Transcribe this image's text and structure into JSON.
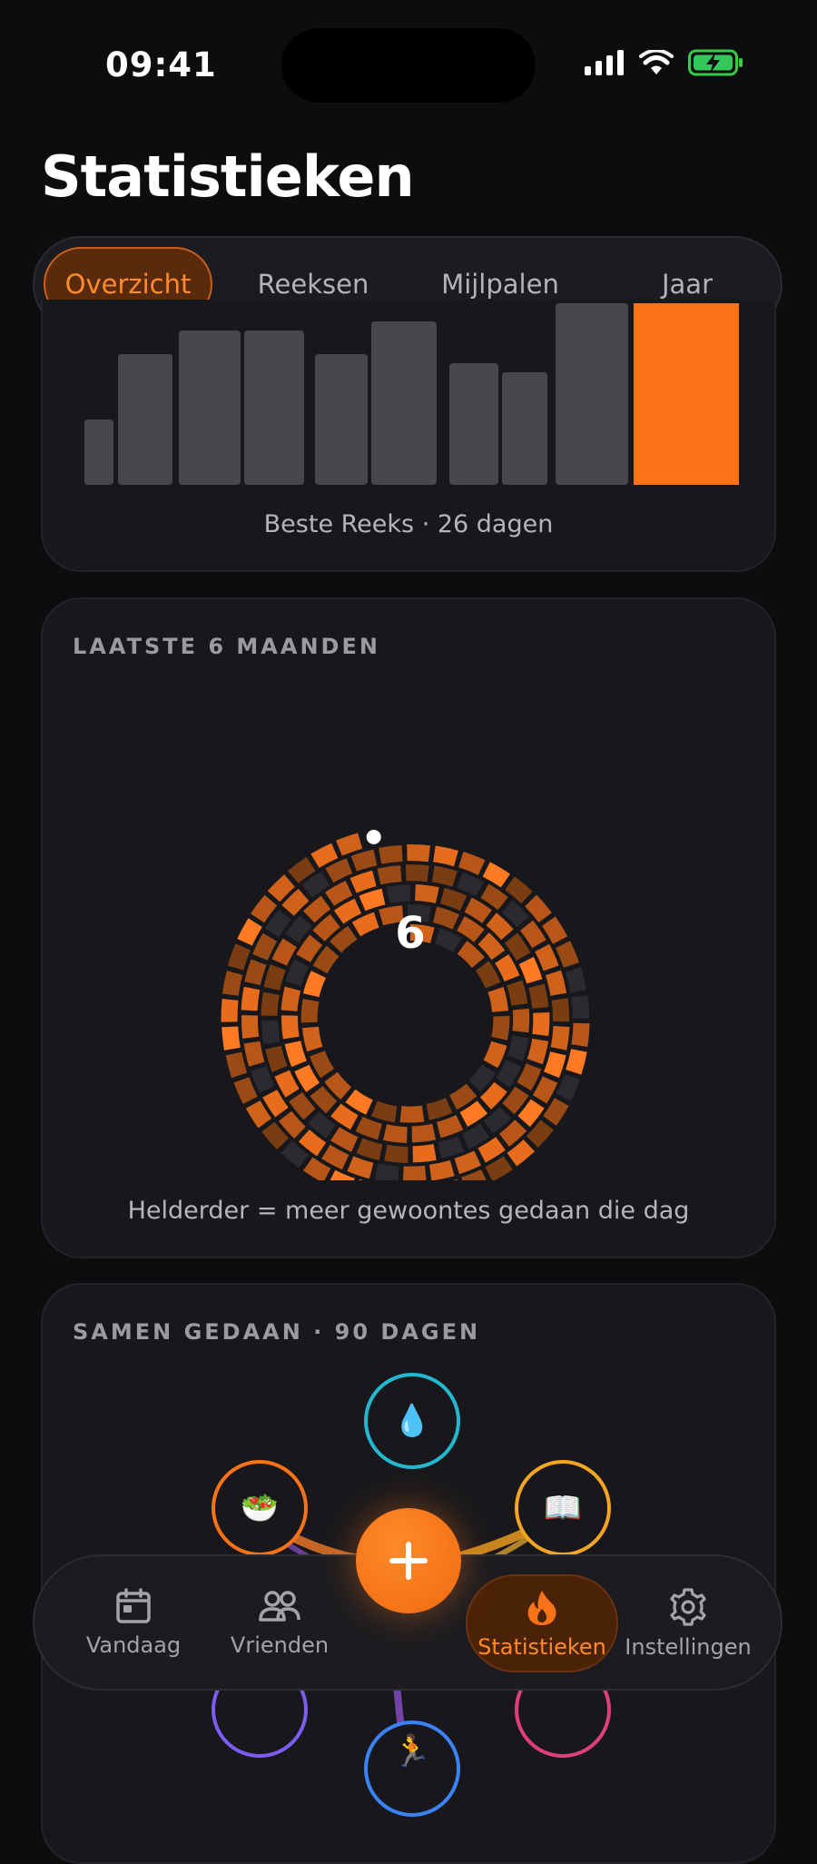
{
  "status_bar": {
    "time": "09:41"
  },
  "page": {
    "title": "Statistieken"
  },
  "tabs": [
    {
      "label": "Overzicht",
      "active": true
    },
    {
      "label": "Reeksen",
      "active": false
    },
    {
      "label": "Mijlpalen",
      "active": false
    },
    {
      "label": "Jaar",
      "active": false
    }
  ],
  "streak_card": {
    "caption": "Beste Reeks · 26 dagen",
    "bars": [
      0.36,
      0.72,
      0.85,
      0.85,
      0.72,
      0.9,
      0.67,
      0.62,
      1.0,
      1.0
    ],
    "highlight_index": 9,
    "colors": {
      "bar": "#48484c",
      "highlight": "#f97316"
    }
  },
  "spiral_card": {
    "label": "LAATSTE 6 MAANDEN",
    "center_value": "6",
    "caption": "Helderder = meer gewoontes gedaan die dag"
  },
  "together_card": {
    "label": "SAMEN GEDAAN · 90 DAGEN",
    "habits": [
      {
        "icon": "water-drop-icon",
        "glyph": "💧",
        "color": "#22b8cf"
      },
      {
        "icon": "salad-icon",
        "glyph": "🥗",
        "color": "#f97316"
      },
      {
        "icon": "book-icon",
        "glyph": "📖",
        "color": "#f5a524"
      },
      {
        "icon": "meditation-icon",
        "glyph": "",
        "color": "#7c5cf2"
      },
      {
        "icon": "heart-icon",
        "glyph": "",
        "color": "#e0407a"
      },
      {
        "icon": "runner-icon",
        "glyph": "🏃",
        "color": "#3b82f6"
      }
    ]
  },
  "nav": {
    "items": [
      {
        "label": "Vandaag",
        "icon": "calendar-icon"
      },
      {
        "label": "Vrienden",
        "icon": "friends-icon"
      },
      {
        "label": "Statistieken",
        "icon": "flame-icon",
        "active": true
      },
      {
        "label": "Instellingen",
        "icon": "gear-icon"
      }
    ],
    "add_button": "plus-icon"
  },
  "colors": {
    "accent": "#f97316",
    "background": "#0d0d0f",
    "card": "#18181c"
  }
}
